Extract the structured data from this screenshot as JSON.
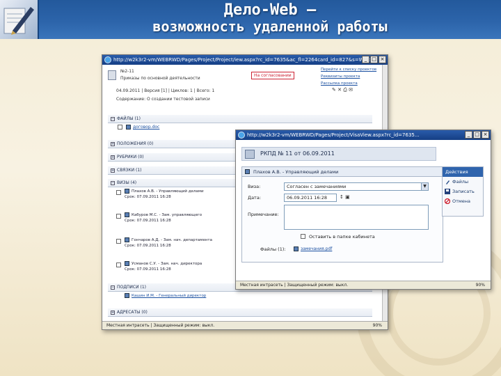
{
  "slide": {
    "title_line1": "Дело-Web –",
    "title_line2": "возможность удаленной работы"
  },
  "main_window": {
    "title": "http://w2k3r2-vm/WEBRWD/Pages/Project/Project/iew.aspx?rc_id=7635&ac_fl=2264card_id=827&s=Wind...",
    "doc_number": "№2-11",
    "doc_type": "Приказы по основной деятельности",
    "red_label": "На согласовании",
    "links": [
      "Перейти к списку проектов",
      "Реквизиты проекта",
      "Рассылка проекта"
    ],
    "date_row": "04.09.2011 | Версия [1] | Циклов: 1 | Всего: 1",
    "summary_row": "Содержание: О создании тестовой записи",
    "sections": [
      "ФАЙЛЫ (1)",
      "ПОЛОЖЕНИЯ (0)",
      "РУБРИКИ (0)",
      "СВЯЗКИ (1)",
      "ВИЗЫ (4)",
      "ПОДПИСИ (1)",
      "АДРЕСАТЫ (0)"
    ],
    "file_name": "договор.doc",
    "visas": [
      {
        "name": "Плахов А.В. - Управляющий делами",
        "term": "Срок: 07.09.2011 16:28"
      },
      {
        "name": "Кабуров М.С. - Зам. управляющего",
        "term": "Срок: 07.09.2011 16:28"
      },
      {
        "name": "Гончаров А.Д. - Зам. нач. департамента",
        "term": "Срок: 07.09.2011 16:28"
      },
      {
        "name": "Усманов С.У. - Зам. нач. директора",
        "term": "Срок: 07.09.2011 16:28"
      }
    ],
    "signer": "Кашин И.М. - Генеральный директор",
    "status": "Местная интрасеть | Защищенный режим: выкл.",
    "zoom": "90%"
  },
  "popup_window": {
    "title": "http://w2k3r2-vm/WEBRWD/Pages/Project/VisaView.aspx?rc_id=7635...",
    "header": "РКПД № 11 от 06.09.2011",
    "panel_title": "Плахов А.В. - Управляющий делами",
    "visa_label": "Виза:",
    "visa_value": "Согласен с замечаниями",
    "date_label": "Дата:",
    "date_value": "06.09.2011 16:28",
    "comment_label": "Примечание:",
    "checkbox_label": "Оставить в папке кабинета",
    "file_label": "Файлы (1):",
    "file_value": "замечания.pdf",
    "actions_title": "Действия",
    "actions": [
      "Файлы",
      "Записать",
      "Отмена"
    ],
    "status": "Местная интрасеть | Защищенный режим: выкл.",
    "zoom": "90%"
  }
}
